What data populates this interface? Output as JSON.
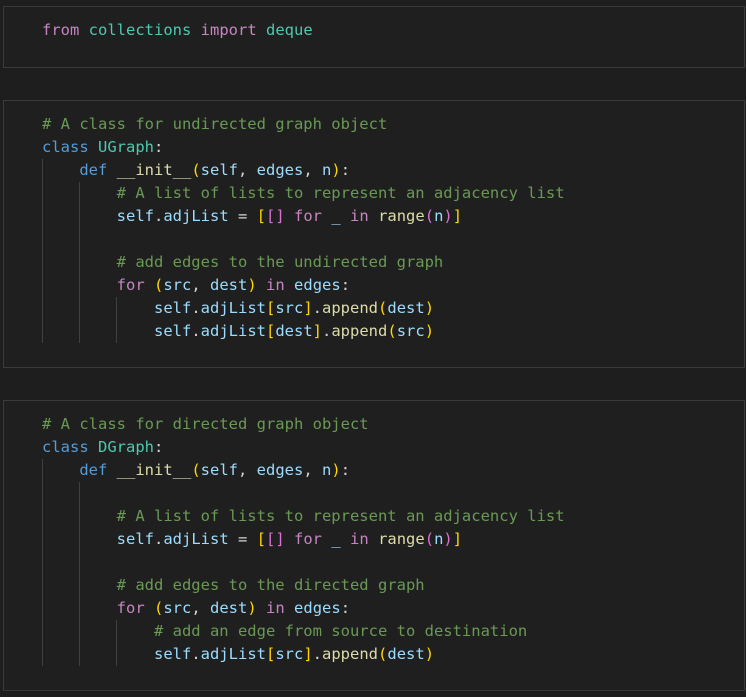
{
  "cells": [
    {
      "lines": [
        [
          [
            "kw",
            "from"
          ],
          [
            "plain",
            " "
          ],
          [
            "mod",
            "collections"
          ],
          [
            "plain",
            " "
          ],
          [
            "kw",
            "import"
          ],
          [
            "plain",
            " "
          ],
          [
            "mod",
            "deque"
          ]
        ]
      ]
    },
    {
      "lines": [
        [
          [
            "com",
            "# A class for undirected graph object"
          ]
        ],
        [
          [
            "kw-blue",
            "class"
          ],
          [
            "plain",
            " "
          ],
          [
            "cls",
            "UGraph"
          ],
          [
            "plain",
            ":"
          ]
        ],
        [
          [
            "plain",
            "    "
          ],
          [
            "kw-blue",
            "def"
          ],
          [
            "plain",
            " "
          ],
          [
            "fn",
            "__init__"
          ],
          [
            "br1",
            "("
          ],
          [
            "param",
            "self"
          ],
          [
            "plain",
            ", "
          ],
          [
            "param",
            "edges"
          ],
          [
            "plain",
            ", "
          ],
          [
            "param",
            "n"
          ],
          [
            "br1",
            ")"
          ],
          [
            "plain",
            ":"
          ]
        ],
        [
          [
            "plain",
            "        "
          ],
          [
            "com",
            "# A list of lists to represent an adjacency list"
          ]
        ],
        [
          [
            "plain",
            "        "
          ],
          [
            "var",
            "self"
          ],
          [
            "plain",
            "."
          ],
          [
            "var",
            "adjList"
          ],
          [
            "plain",
            " = "
          ],
          [
            "br1",
            "["
          ],
          [
            "br2",
            "[]"
          ],
          [
            "plain",
            " "
          ],
          [
            "kw",
            "for"
          ],
          [
            "plain",
            " "
          ],
          [
            "var",
            "_"
          ],
          [
            "plain",
            " "
          ],
          [
            "kw",
            "in"
          ],
          [
            "plain",
            " "
          ],
          [
            "builtin",
            "range"
          ],
          [
            "br2",
            "("
          ],
          [
            "var",
            "n"
          ],
          [
            "br2",
            ")"
          ],
          [
            "br1",
            "]"
          ]
        ],
        [],
        [
          [
            "plain",
            "        "
          ],
          [
            "com",
            "# add edges to the undirected graph"
          ]
        ],
        [
          [
            "plain",
            "        "
          ],
          [
            "kw",
            "for"
          ],
          [
            "plain",
            " "
          ],
          [
            "br1",
            "("
          ],
          [
            "var",
            "src"
          ],
          [
            "plain",
            ", "
          ],
          [
            "var",
            "dest"
          ],
          [
            "br1",
            ")"
          ],
          [
            "plain",
            " "
          ],
          [
            "kw",
            "in"
          ],
          [
            "plain",
            " "
          ],
          [
            "var",
            "edges"
          ],
          [
            "plain",
            ":"
          ]
        ],
        [
          [
            "plain",
            "            "
          ],
          [
            "var",
            "self"
          ],
          [
            "plain",
            "."
          ],
          [
            "var",
            "adjList"
          ],
          [
            "br1",
            "["
          ],
          [
            "var",
            "src"
          ],
          [
            "br1",
            "]"
          ],
          [
            "plain",
            "."
          ],
          [
            "fn",
            "append"
          ],
          [
            "br1",
            "("
          ],
          [
            "var",
            "dest"
          ],
          [
            "br1",
            ")"
          ]
        ],
        [
          [
            "plain",
            "            "
          ],
          [
            "var",
            "self"
          ],
          [
            "plain",
            "."
          ],
          [
            "var",
            "adjList"
          ],
          [
            "br1",
            "["
          ],
          [
            "var",
            "dest"
          ],
          [
            "br1",
            "]"
          ],
          [
            "plain",
            "."
          ],
          [
            "fn",
            "append"
          ],
          [
            "br1",
            "("
          ],
          [
            "var",
            "src"
          ],
          [
            "br1",
            ")"
          ]
        ]
      ]
    },
    {
      "lines": [
        [
          [
            "com",
            "# A class for directed graph object"
          ]
        ],
        [
          [
            "kw-blue",
            "class"
          ],
          [
            "plain",
            " "
          ],
          [
            "cls",
            "DGraph"
          ],
          [
            "plain",
            ":"
          ]
        ],
        [
          [
            "plain",
            "    "
          ],
          [
            "kw-blue",
            "def"
          ],
          [
            "plain",
            " "
          ],
          [
            "fn",
            "__init__"
          ],
          [
            "br1",
            "("
          ],
          [
            "param",
            "self"
          ],
          [
            "plain",
            ", "
          ],
          [
            "param",
            "edges"
          ],
          [
            "plain",
            ", "
          ],
          [
            "param",
            "n"
          ],
          [
            "br1",
            ")"
          ],
          [
            "plain",
            ":"
          ]
        ],
        [],
        [
          [
            "plain",
            "        "
          ],
          [
            "com",
            "# A list of lists to represent an adjacency list"
          ]
        ],
        [
          [
            "plain",
            "        "
          ],
          [
            "var",
            "self"
          ],
          [
            "plain",
            "."
          ],
          [
            "var",
            "adjList"
          ],
          [
            "plain",
            " = "
          ],
          [
            "br1",
            "["
          ],
          [
            "br2",
            "[]"
          ],
          [
            "plain",
            " "
          ],
          [
            "kw",
            "for"
          ],
          [
            "plain",
            " "
          ],
          [
            "var",
            "_"
          ],
          [
            "plain",
            " "
          ],
          [
            "kw",
            "in"
          ],
          [
            "plain",
            " "
          ],
          [
            "builtin",
            "range"
          ],
          [
            "br2",
            "("
          ],
          [
            "var",
            "n"
          ],
          [
            "br2",
            ")"
          ],
          [
            "br1",
            "]"
          ]
        ],
        [],
        [
          [
            "plain",
            "        "
          ],
          [
            "com",
            "# add edges to the directed graph"
          ]
        ],
        [
          [
            "plain",
            "        "
          ],
          [
            "kw",
            "for"
          ],
          [
            "plain",
            " "
          ],
          [
            "br1",
            "("
          ],
          [
            "var",
            "src"
          ],
          [
            "plain",
            ", "
          ],
          [
            "var",
            "dest"
          ],
          [
            "br1",
            ")"
          ],
          [
            "plain",
            " "
          ],
          [
            "kw",
            "in"
          ],
          [
            "plain",
            " "
          ],
          [
            "var",
            "edges"
          ],
          [
            "plain",
            ":"
          ]
        ],
        [
          [
            "plain",
            "            "
          ],
          [
            "com",
            "# add an edge from source to destination"
          ]
        ],
        [
          [
            "plain",
            "            "
          ],
          [
            "var",
            "self"
          ],
          [
            "plain",
            "."
          ],
          [
            "var",
            "adjList"
          ],
          [
            "br1",
            "["
          ],
          [
            "var",
            "src"
          ],
          [
            "br1",
            "]"
          ],
          [
            "plain",
            "."
          ],
          [
            "fn",
            "append"
          ],
          [
            "br1",
            "("
          ],
          [
            "var",
            "dest"
          ],
          [
            "br1",
            ")"
          ]
        ]
      ]
    }
  ]
}
